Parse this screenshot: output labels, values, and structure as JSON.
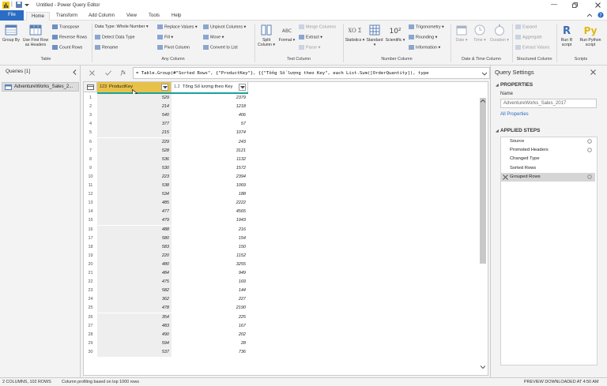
{
  "window": {
    "title": "Untitled - Power Query Editor"
  },
  "menu": {
    "tabs": [
      "File",
      "Home",
      "Transform",
      "Add Column",
      "View",
      "Tools",
      "Help"
    ]
  },
  "ribbon": {
    "table": {
      "group_by": "Group By",
      "first_row_headers": "Use First Row as Headers",
      "transpose": "Transpose",
      "reverse_rows": "Reverse Rows",
      "count_rows": "Count Rows",
      "label": "Table"
    },
    "any_column": {
      "data_type": "Data Type: Whole Number",
      "detect_type": "Detect Data Type",
      "rename": "Rename",
      "replace_values": "Replace Values",
      "fill": "Fill",
      "pivot_column": "Pivot Column",
      "unpivot_columns": "Unpivot Columns",
      "move": "Move",
      "convert_to_list": "Convert to List",
      "label": "Any Column"
    },
    "text_column": {
      "split_column": "Split Column",
      "format": "Format",
      "merge_columns": "Merge Columns",
      "extract": "Extract",
      "parse": "Parse",
      "abc_glyph": "ABC",
      "label": "Text Column"
    },
    "number_column": {
      "statistics": "Statistics",
      "standard": "Standard",
      "scientific": "Scientific",
      "trigonometry": "Trigonometry",
      "rounding": "Rounding",
      "information": "Information",
      "sigma_glyph": "XO Σ",
      "power_glyph": "10²",
      "label": "Number Column"
    },
    "datetime_column": {
      "date": "Date",
      "time": "Time",
      "duration": "Duration",
      "label": "Date & Time Column"
    },
    "structured_column": {
      "expand": "Expand",
      "aggregate": "Aggregate",
      "extract_values": "Extract Values",
      "label": "Structured Column"
    },
    "scripts": {
      "run_r": "Run R script",
      "run_python": "Run Python script",
      "r_glyph": "R",
      "py_glyph": "Py",
      "label": "Scripts"
    }
  },
  "queries": {
    "header": "Queries [1]",
    "items": [
      "AdventureWorks_Sales_2..."
    ]
  },
  "formula": {
    "fx": "fx",
    "text": "= Table.Group(#\"Sorted Rows\", {\"ProductKey\"}, {{\"Tổng Số lượng theo Key\", each List.Sum([OrderQuantity]), type"
  },
  "grid": {
    "col1_type": "123",
    "col1_name": "ProductKey",
    "col2_type": "1.2",
    "col2_name": "Tổng Số lượng theo Key",
    "rows": [
      [
        1,
        529,
        2379
      ],
      [
        2,
        214,
        1218
      ],
      [
        3,
        540,
        406
      ],
      [
        4,
        377,
        57
      ],
      [
        5,
        215,
        1074
      ],
      [
        6,
        229,
        243
      ],
      [
        7,
        528,
        3121
      ],
      [
        8,
        536,
        1132
      ],
      [
        9,
        530,
        1572
      ],
      [
        10,
        223,
        2394
      ],
      [
        11,
        538,
        1069
      ],
      [
        12,
        534,
        188
      ],
      [
        13,
        485,
        2222
      ],
      [
        14,
        477,
        4565
      ],
      [
        15,
        479,
        1943
      ],
      [
        16,
        488,
        216
      ],
      [
        17,
        580,
        154
      ],
      [
        18,
        583,
        150
      ],
      [
        19,
        220,
        1152
      ],
      [
        20,
        480,
        3255
      ],
      [
        21,
        484,
        949
      ],
      [
        22,
        475,
        169
      ],
      [
        23,
        582,
        144
      ],
      [
        24,
        362,
        227
      ],
      [
        25,
        478,
        2190
      ],
      [
        26,
        354,
        225
      ],
      [
        27,
        483,
        167
      ],
      [
        28,
        490,
        202
      ],
      [
        29,
        594,
        28
      ],
      [
        30,
        537,
        736
      ]
    ]
  },
  "settings": {
    "title": "Query Settings",
    "properties_header": "PROPERTIES",
    "name_label": "Name",
    "name_value": "AdventureWorks_Sales_2017",
    "all_properties": "All Properties",
    "steps_header": "APPLIED STEPS",
    "steps": [
      "Source",
      "Promoted Headers",
      "Changed Type",
      "Sorted Rows",
      "Grouped Rows"
    ]
  },
  "status": {
    "columns_rows": "2 COLUMNS, 102 ROWS",
    "profiling": "Column profiling based on top 1000 rows",
    "preview": "PREVIEW DOWNLOADED AT 4:50 AM"
  },
  "colors": {
    "accent": "#2b6cc4",
    "header_selected": "#e8c14a",
    "step_selected": "#d6d6d6",
    "quality_bar": "#1aa39b"
  }
}
